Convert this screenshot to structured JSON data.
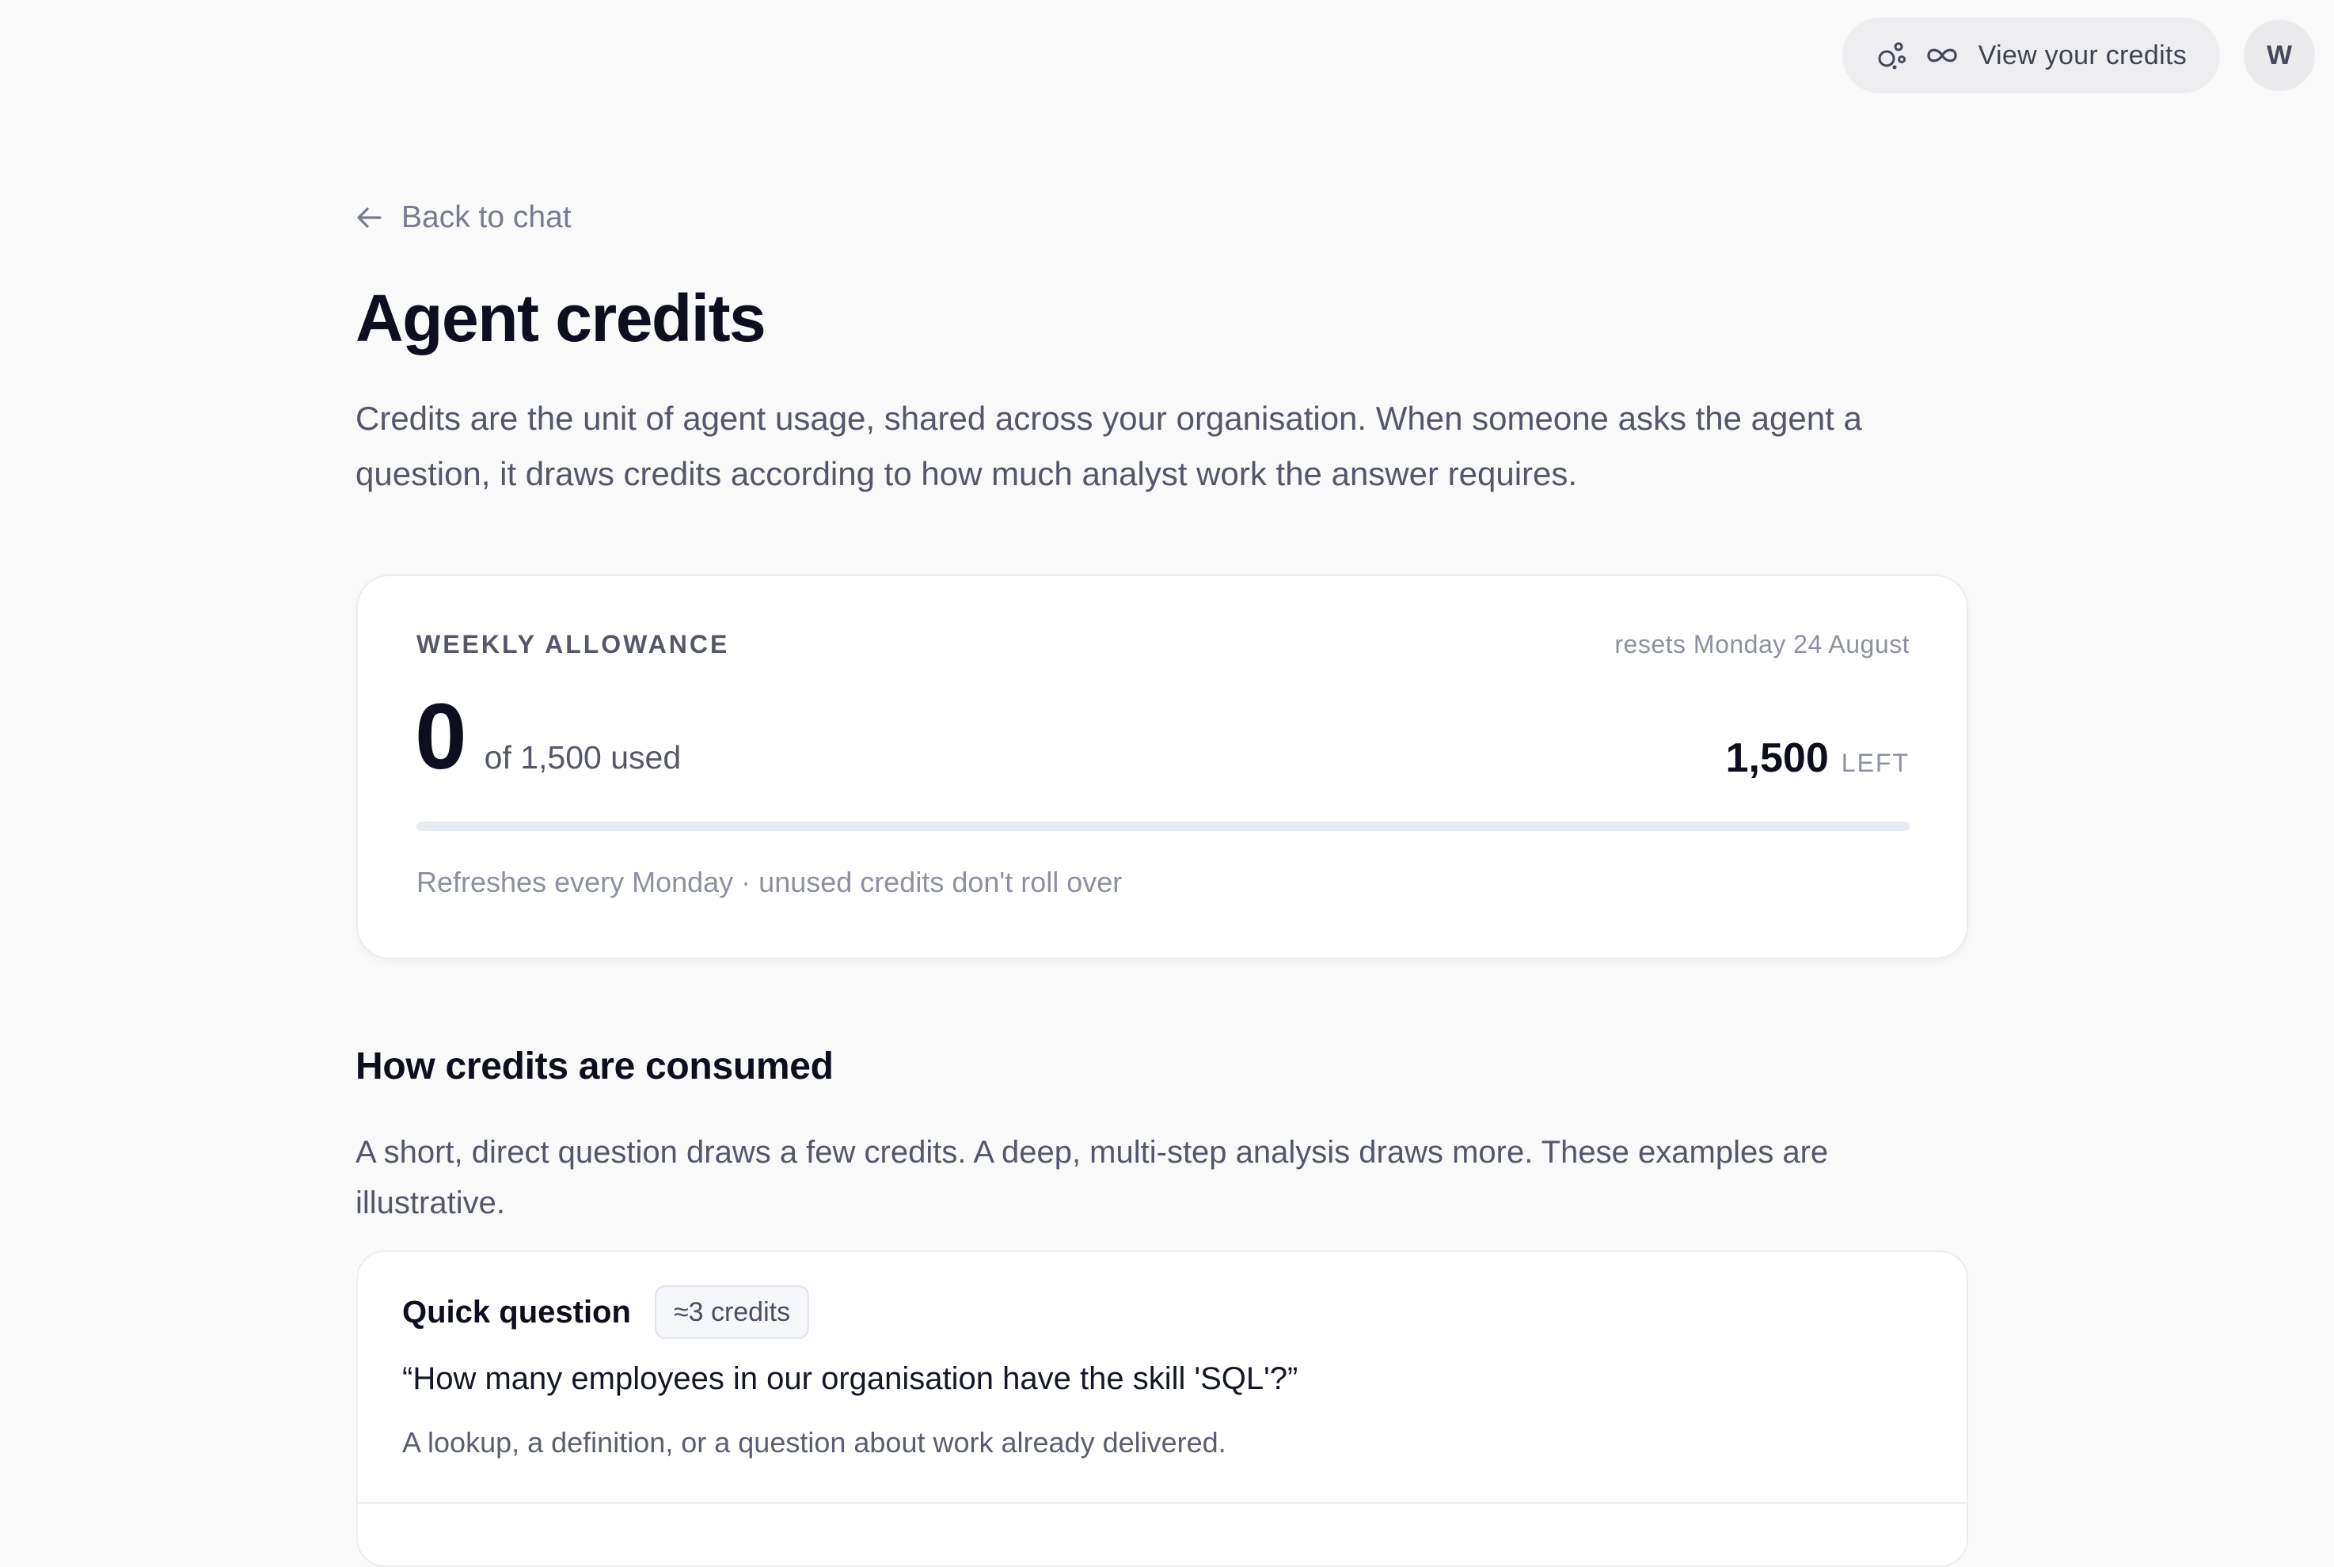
{
  "header": {
    "credits_button_label": "View your credits",
    "avatar_initial": "W",
    "icons": [
      "sparkle-icon",
      "infinity-icon"
    ]
  },
  "nav": {
    "back_label": "Back to chat"
  },
  "page": {
    "title": "Agent credits",
    "description": "Credits are the unit of agent usage, shared across your organisation. When someone asks the agent a question, it draws credits according to how much analyst work the answer requires."
  },
  "allowance": {
    "label": "WEEKLY ALLOWANCE",
    "resets": "resets Monday 24 August",
    "used": "0",
    "used_text": "of 1,500 used",
    "left": "1,500",
    "left_label": "LEFT",
    "progress_fraction": 0,
    "note": "Refreshes every Monday · unused credits don't roll over",
    "colors": {
      "track": "#e8eaf6",
      "fill": "#4f5bd5"
    }
  },
  "consumption": {
    "title": "How credits are consumed",
    "description": "A short, direct question draws a few credits. A deep, multi-step analysis draws more. These examples are illustrative.",
    "examples": [
      {
        "title": "Quick question",
        "badge": "≈3 credits",
        "quote": "“How many employees in our organisation have the skill 'SQL'?”",
        "note": "A lookup, a definition, or a question about work already delivered."
      }
    ]
  }
}
